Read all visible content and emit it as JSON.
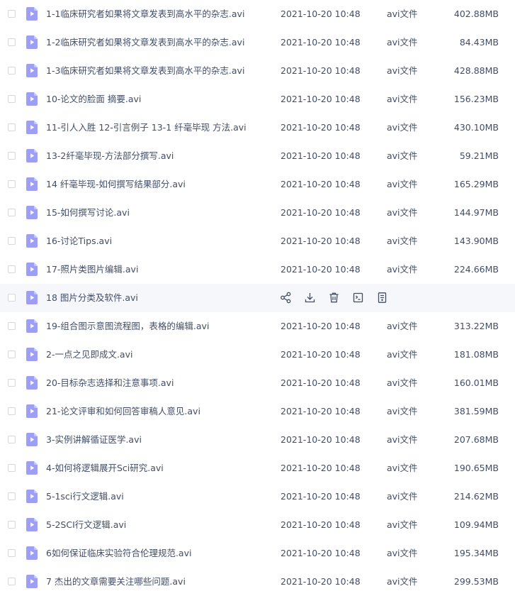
{
  "type_label": "avi文件",
  "colors": {
    "icon_bg": "#9e9ef5",
    "hover_row": "#f6f7fb",
    "text": "#424e67"
  },
  "hover_row_index": 10,
  "hover_actions": [
    {
      "name": "share-icon"
    },
    {
      "name": "download-icon"
    },
    {
      "name": "delete-icon"
    },
    {
      "name": "rename-icon"
    },
    {
      "name": "more-icon"
    }
  ],
  "files": [
    {
      "name": "1-1临床研究者如果将文章发表到高水平的杂志.avi",
      "date": "2021-10-20 10:48",
      "type": "avi文件",
      "size": "402.88MB"
    },
    {
      "name": "1-2临床研究者如果将文章发表到高水平的杂志.avi",
      "date": "2021-10-20 10:48",
      "type": "avi文件",
      "size": "84.43MB"
    },
    {
      "name": "1-3临床研究者如果将文章发表到高水平的杂志.avi",
      "date": "2021-10-20 10:48",
      "type": "avi文件",
      "size": "428.88MB"
    },
    {
      "name": "10-论文的脸面 摘要.avi",
      "date": "2021-10-20 10:48",
      "type": "avi文件",
      "size": "156.23MB"
    },
    {
      "name": "11-引人入胜 12-引言例子 13-1 纤毫毕现 方法.avi",
      "date": "2021-10-20 10:48",
      "type": "avi文件",
      "size": "430.10MB"
    },
    {
      "name": "13-2纤毫毕现-方法部分撰写.avi",
      "date": "2021-10-20 10:48",
      "type": "avi文件",
      "size": "59.21MB"
    },
    {
      "name": "14 纤毫毕现-如何撰写结果部分.avi",
      "date": "2021-10-20 10:48",
      "type": "avi文件",
      "size": "165.29MB"
    },
    {
      "name": "15-如何撰写讨论.avi",
      "date": "2021-10-20 10:48",
      "type": "avi文件",
      "size": "144.97MB"
    },
    {
      "name": "16-讨论Tips.avi",
      "date": "2021-10-20 10:48",
      "type": "avi文件",
      "size": "143.90MB"
    },
    {
      "name": "17-照片类图片编辑.avi",
      "date": "2021-10-20 10:48",
      "type": "avi文件",
      "size": "224.66MB"
    },
    {
      "name": "18 图片分类及软件.avi",
      "date": "",
      "type": "",
      "size": ""
    },
    {
      "name": "19-组合图示意图流程图，表格的编辑.avi",
      "date": "2021-10-20 10:48",
      "type": "avi文件",
      "size": "313.22MB"
    },
    {
      "name": "2-一点之见即成文.avi",
      "date": "2021-10-20 10:48",
      "type": "avi文件",
      "size": "181.08MB"
    },
    {
      "name": "20-目标杂志选择和注意事项.avi",
      "date": "2021-10-20 10:48",
      "type": "avi文件",
      "size": "160.01MB"
    },
    {
      "name": "21-论文评审和如何回答审稿人意见.avi",
      "date": "2021-10-20 10:48",
      "type": "avi文件",
      "size": "381.59MB"
    },
    {
      "name": "3-实例讲解循证医学.avi",
      "date": "2021-10-20 10:48",
      "type": "avi文件",
      "size": "207.68MB"
    },
    {
      "name": "4-如何将逻辑展开Sci研究.avi",
      "date": "2021-10-20 10:48",
      "type": "avi文件",
      "size": "190.65MB"
    },
    {
      "name": "5-1sci行文逻辑.avi",
      "date": "2021-10-20 10:48",
      "type": "avi文件",
      "size": "214.62MB"
    },
    {
      "name": "5-2SCI行文逻辑.avi",
      "date": "2021-10-20 10:48",
      "type": "avi文件",
      "size": "109.94MB"
    },
    {
      "name": "6如何保证临床实验符合伦理规范.avi",
      "date": "2021-10-20 10:48",
      "type": "avi文件",
      "size": "195.34MB"
    },
    {
      "name": "7 杰出的文章需要关注哪些问题.avi",
      "date": "2021-10-20 10:48",
      "type": "avi文件",
      "size": "299.53MB"
    }
  ]
}
